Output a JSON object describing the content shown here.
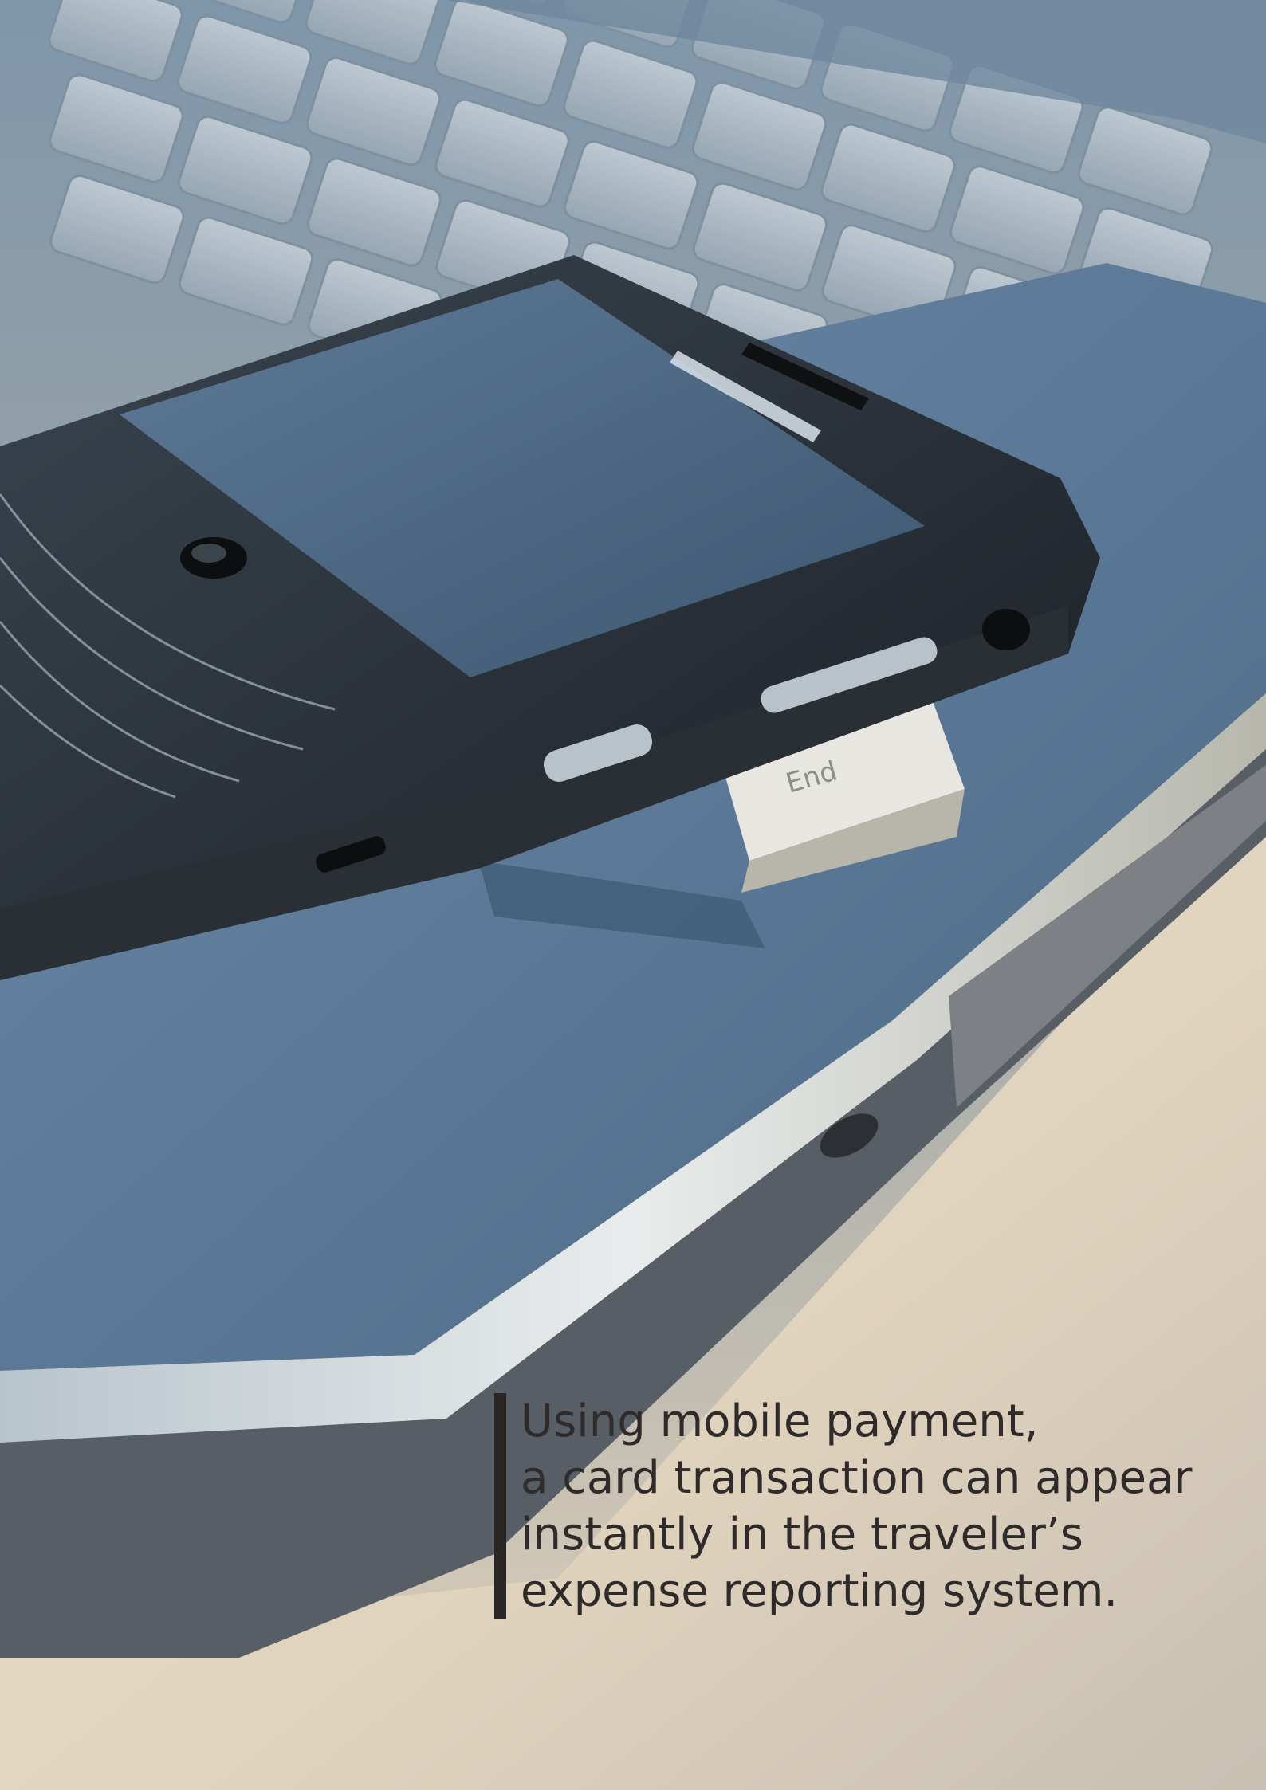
{
  "photo": {
    "subject": "smartphone resting on a laptop keyboard",
    "key_label": "End"
  },
  "caption": {
    "lines": [
      "Using mobile payment,",
      "a card transaction can appear",
      "instantly in the traveler’s",
      "expense reporting system."
    ]
  },
  "colors": {
    "caption_text": "#2f2b2b",
    "caption_rule": "#2a2626",
    "laptop_body": "#6b8aa5",
    "table_surface": "#e0d3bd"
  }
}
